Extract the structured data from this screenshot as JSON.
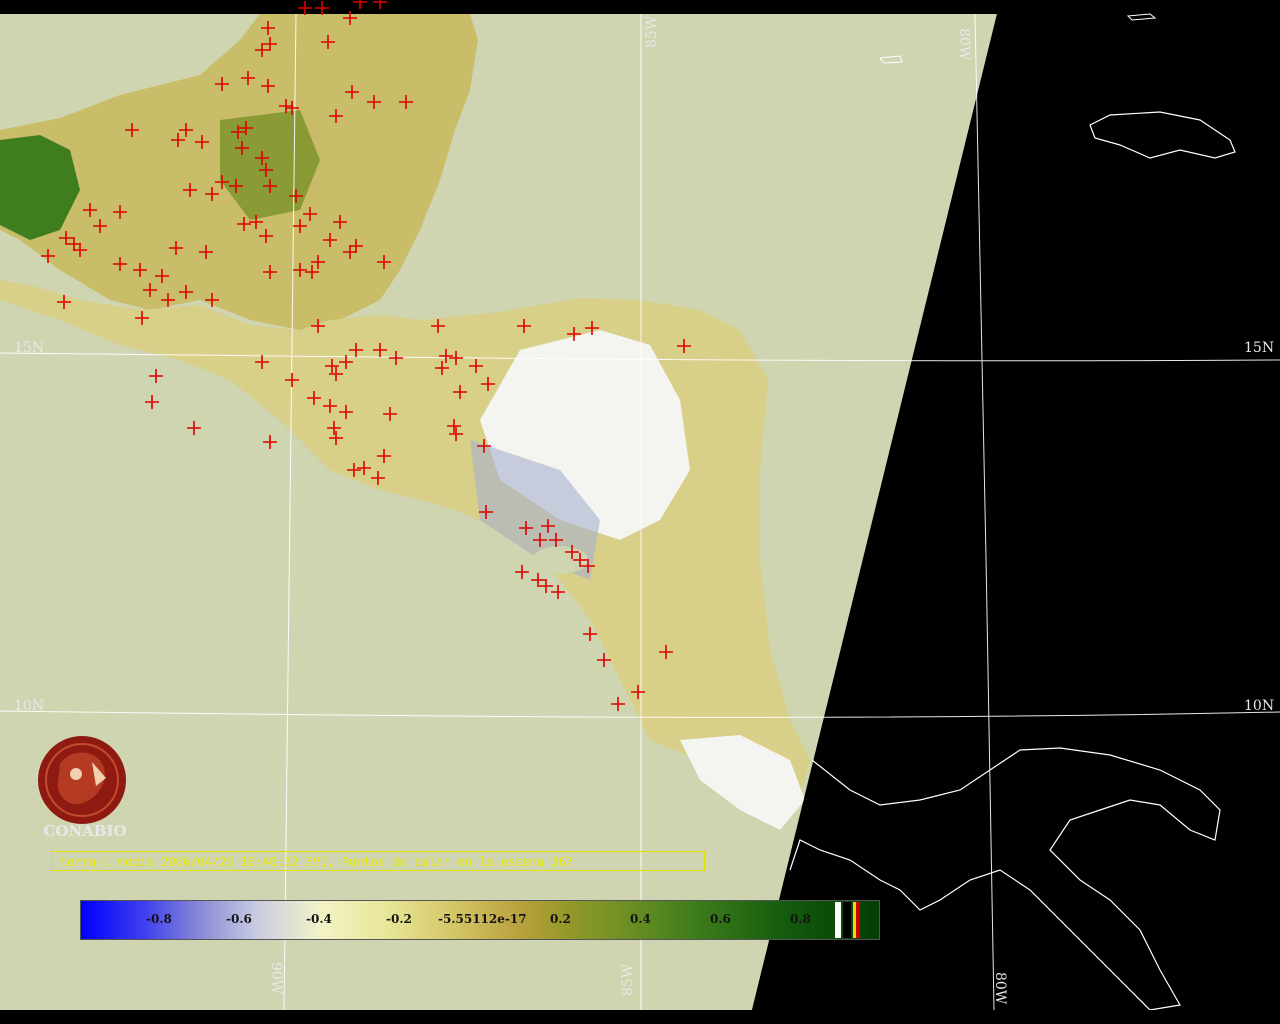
{
  "map": {
    "caption": "terra-1 modis 2006/04/20 16:40:32 EVI, Puntos de calor en la escena 367",
    "organization": "CONABIO",
    "grid_labels": {
      "lat_15_left": "15N",
      "lat_15_right": "15N",
      "lat_10_left": "10N",
      "lat_10_right": "10N",
      "lon_85_top": "85W",
      "lon_80_top": "80W",
      "lon_90_bottom": "90W",
      "lon_85_bottom": "85W",
      "lon_80_bottom": "80W"
    },
    "colorbar": {
      "ticks": [
        "-0.8",
        "-0.6",
        "-0.4",
        "-0.2",
        "-5.55112e-17",
        "0.2",
        "0.4",
        "0.6",
        "0.8"
      ],
      "colors": {
        "low": "#0000ff",
        "mid": "#f3f3c8",
        "high": "#063d06",
        "hotspot": "#e00000",
        "ocean": "#cfd5b0",
        "no_data": "#000000"
      }
    },
    "hotspot_count": 367
  }
}
